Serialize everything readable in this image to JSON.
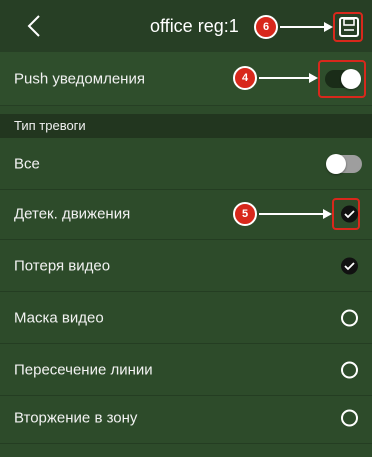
{
  "header": {
    "back_icon": "chevron-left-icon",
    "title": "office reg:1",
    "save_icon": "floppy-disk-icon"
  },
  "push": {
    "label": "Push уведомления",
    "enabled": true
  },
  "section": {
    "label": "Тип тревоги"
  },
  "rows": [
    {
      "label": "Все",
      "control": "toggle",
      "state": false
    },
    {
      "label": "Детек. движения",
      "control": "check",
      "state": true
    },
    {
      "label": "Потеря видео",
      "control": "check",
      "state": true
    },
    {
      "label": "Маска видео",
      "control": "check",
      "state": false
    },
    {
      "label": "Пересечение линии",
      "control": "check",
      "state": false
    },
    {
      "label": "Вторжение в зону",
      "control": "check",
      "state": false
    }
  ],
  "annotations": [
    {
      "number": "6",
      "target": "save-button"
    },
    {
      "number": "4",
      "target": "push-toggle"
    },
    {
      "number": "5",
      "target": "motion-detect-check"
    }
  ],
  "colors": {
    "background": "#2d4b2a",
    "header": "#273f25",
    "section": "#22361f",
    "annotation": "#d8281c"
  }
}
